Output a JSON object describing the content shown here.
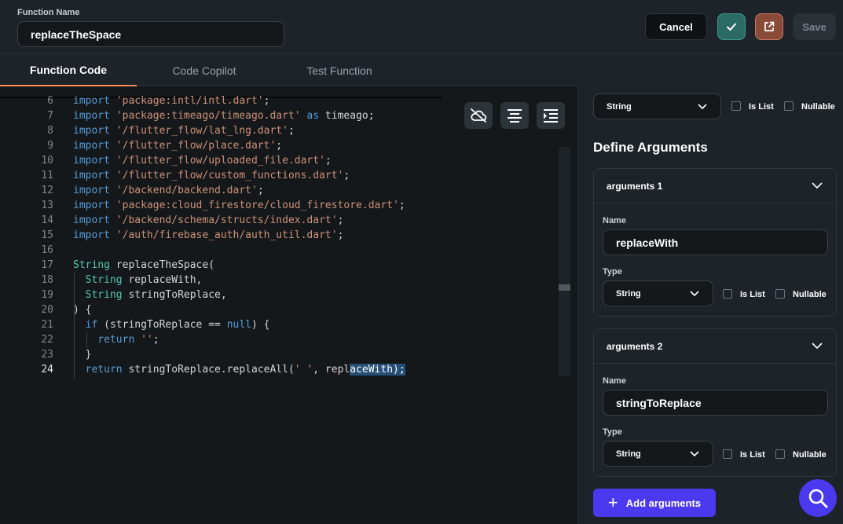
{
  "header": {
    "function_name_label": "Function Name",
    "function_name_value": "replaceTheSpace",
    "cancel_label": "Cancel",
    "save_label": "Save"
  },
  "tabs": [
    {
      "label": "Function Code",
      "active": true
    },
    {
      "label": "Code Copilot",
      "active": false
    },
    {
      "label": "Test Function",
      "active": false
    }
  ],
  "editor": {
    "current_line": 24,
    "lines": [
      {
        "n": "6",
        "t": [
          [
            "kw",
            "import "
          ],
          [
            "st",
            "'package:intl/intl.dart'"
          ],
          [
            "id",
            ";"
          ]
        ]
      },
      {
        "n": "7",
        "t": [
          [
            "kw",
            "import "
          ],
          [
            "st",
            "'package:timeago/timeago.dart'"
          ],
          [
            "kw",
            " as "
          ],
          [
            "id",
            "timeago;"
          ]
        ]
      },
      {
        "n": "8",
        "t": [
          [
            "kw",
            "import "
          ],
          [
            "st",
            "'/flutter_flow/lat_lng.dart'"
          ],
          [
            "id",
            ";"
          ]
        ]
      },
      {
        "n": "9",
        "t": [
          [
            "kw",
            "import "
          ],
          [
            "st",
            "'/flutter_flow/place.dart'"
          ],
          [
            "id",
            ";"
          ]
        ]
      },
      {
        "n": "10",
        "t": [
          [
            "kw",
            "import "
          ],
          [
            "st",
            "'/flutter_flow/uploaded_file.dart'"
          ],
          [
            "id",
            ";"
          ]
        ]
      },
      {
        "n": "11",
        "t": [
          [
            "kw",
            "import "
          ],
          [
            "st",
            "'/flutter_flow/custom_functions.dart'"
          ],
          [
            "id",
            ";"
          ]
        ]
      },
      {
        "n": "12",
        "t": [
          [
            "kw",
            "import "
          ],
          [
            "st",
            "'/backend/backend.dart'"
          ],
          [
            "id",
            ";"
          ]
        ]
      },
      {
        "n": "13",
        "t": [
          [
            "kw",
            "import "
          ],
          [
            "st",
            "'package:cloud_firestore/cloud_firestore.dart'"
          ],
          [
            "id",
            ";"
          ]
        ]
      },
      {
        "n": "14",
        "t": [
          [
            "kw",
            "import "
          ],
          [
            "st",
            "'/backend/schema/structs/index.dart'"
          ],
          [
            "id",
            ";"
          ]
        ]
      },
      {
        "n": "15",
        "t": [
          [
            "kw",
            "import "
          ],
          [
            "st",
            "'/auth/firebase_auth/auth_util.dart'"
          ],
          [
            "id",
            ";"
          ]
        ]
      },
      {
        "n": "16",
        "t": []
      },
      {
        "n": "17",
        "t": [
          [
            "ty",
            "String "
          ],
          [
            "id",
            "replaceTheSpace("
          ]
        ]
      },
      {
        "n": "18",
        "t": [
          [
            "id",
            "  "
          ],
          [
            "ty",
            "String "
          ],
          [
            "id",
            "replaceWith,"
          ]
        ]
      },
      {
        "n": "19",
        "t": [
          [
            "id",
            "  "
          ],
          [
            "ty",
            "String "
          ],
          [
            "id",
            "stringToReplace,"
          ]
        ]
      },
      {
        "n": "20",
        "t": [
          [
            "id",
            ") {"
          ]
        ]
      },
      {
        "n": "21",
        "t": [
          [
            "id",
            "  "
          ],
          [
            "kw",
            "if "
          ],
          [
            "id",
            "(stringToReplace == "
          ],
          [
            "kw",
            "null"
          ],
          [
            "id",
            ") {"
          ]
        ]
      },
      {
        "n": "22",
        "t": [
          [
            "id",
            "    "
          ],
          [
            "kw",
            "return "
          ],
          [
            "st",
            "''"
          ],
          [
            "id",
            ";"
          ]
        ]
      },
      {
        "n": "23",
        "t": [
          [
            "id",
            "  }"
          ]
        ]
      },
      {
        "n": "24",
        "t": [
          [
            "id",
            "  "
          ],
          [
            "kw",
            "return "
          ],
          [
            "id",
            "stringToReplace.replaceAll("
          ],
          [
            "st",
            "' '"
          ],
          [
            "id",
            ", repl"
          ],
          [
            "sel",
            "aceWith);"
          ]
        ]
      }
    ]
  },
  "return_type": {
    "value": "String",
    "is_list_label": "Is List",
    "nullable_label": "Nullable"
  },
  "define_arguments_heading": "Define Arguments",
  "arguments": [
    {
      "title": "arguments 1",
      "name_label": "Name",
      "name_value": "replaceWith",
      "type_label": "Type",
      "type_value": "String",
      "is_list_label": "Is List",
      "nullable_label": "Nullable"
    },
    {
      "title": "arguments 2",
      "name_label": "Name",
      "name_value": "stringToReplace",
      "type_label": "Type",
      "type_value": "String",
      "is_list_label": "Is List",
      "nullable_label": "Nullable"
    }
  ],
  "add_arguments_label": "Add arguments",
  "colors": {
    "accent": "#4b39ef",
    "tab_underline": "#ff8a5b",
    "check_button": "#2c6b63",
    "open_button": "#8a4a38"
  }
}
